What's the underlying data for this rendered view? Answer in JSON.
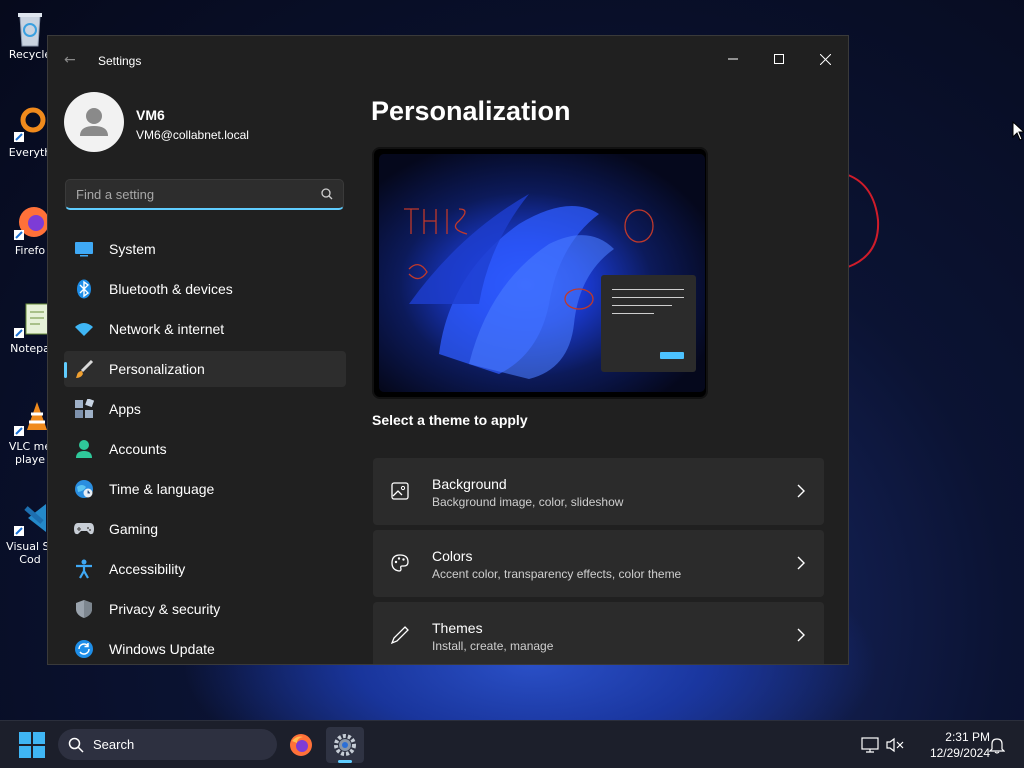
{
  "desktop": {
    "icons": [
      {
        "label": "Recycle",
        "icon": "recycle-bin-icon"
      },
      {
        "label": "Everyth",
        "icon": "everything-icon"
      },
      {
        "label": "Firefo",
        "icon": "firefox-icon"
      },
      {
        "label": "Notepa",
        "icon": "notepad-icon"
      },
      {
        "label": "VLC me",
        "label2": "playe",
        "icon": "vlc-icon"
      },
      {
        "label": "Visual St",
        "label2": "Cod",
        "icon": "vscode-icon"
      }
    ]
  },
  "window": {
    "title": "Settings",
    "minimize": "minimize",
    "maximize": "maximize",
    "close": "close"
  },
  "profile": {
    "name": "VM6",
    "email": "VM6@collabnet.local"
  },
  "search": {
    "placeholder": "Find a setting",
    "value": ""
  },
  "nav": {
    "items": [
      {
        "label": "System",
        "icon": "system-icon"
      },
      {
        "label": "Bluetooth & devices",
        "icon": "bluetooth-icon"
      },
      {
        "label": "Network & internet",
        "icon": "network-icon"
      },
      {
        "label": "Personalization",
        "icon": "brush-icon",
        "active": true
      },
      {
        "label": "Apps",
        "icon": "apps-icon"
      },
      {
        "label": "Accounts",
        "icon": "accounts-icon"
      },
      {
        "label": "Time & language",
        "icon": "globe-icon"
      },
      {
        "label": "Gaming",
        "icon": "gamepad-icon"
      },
      {
        "label": "Accessibility",
        "icon": "accessibility-icon"
      },
      {
        "label": "Privacy & security",
        "icon": "shield-icon"
      },
      {
        "label": "Windows Update",
        "icon": "update-icon"
      }
    ]
  },
  "main": {
    "title": "Personalization",
    "theme_prompt": "Select a theme to apply",
    "cards": [
      {
        "title": "Background",
        "subtitle": "Background image, color, slideshow",
        "icon": "image-icon"
      },
      {
        "title": "Colors",
        "subtitle": "Accent color, transparency effects, color theme",
        "icon": "palette-icon"
      },
      {
        "title": "Themes",
        "subtitle": "Install, create, manage",
        "icon": "pen-icon"
      }
    ]
  },
  "taskbar": {
    "search_label": "Search",
    "time": "2:31 PM",
    "date": "12/29/2024"
  },
  "colors": {
    "accent": "#60cdff",
    "window_bg": "#202020",
    "card_bg": "#2b2b2b",
    "annotation": "#d01c2a"
  }
}
